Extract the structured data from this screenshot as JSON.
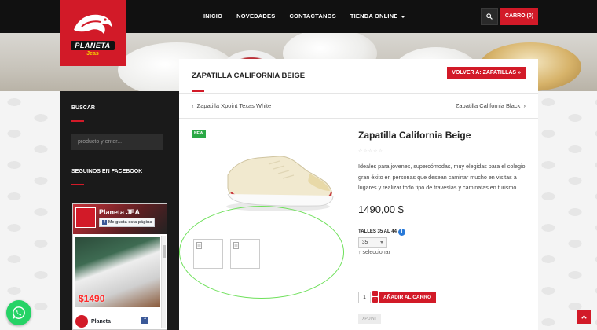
{
  "brand": {
    "logo_text": "PLANETA",
    "logo_sub": "Jeas"
  },
  "nav": {
    "items": [
      "INICIO",
      "NOVEDADES",
      "CONTACTANOS",
      "TIENDA ONLINE"
    ],
    "cart_label": "CARRO (0)"
  },
  "sidebar": {
    "search_title": "BUSCAR",
    "search_placeholder": "producto y enter...",
    "facebook_title": "SEGUINOS EN FACEBOOK",
    "fb_page_name": "Planeta JEA",
    "fb_like_label": "Me gusta esta página",
    "fb_post_price": "$1490",
    "fb_footer_name": "Planeta"
  },
  "page": {
    "title": "ZAPATILLA CALIFORNIA BEIGE",
    "back_button": "VOLVER A: ZAPATILLAS",
    "prev_product": "Zapatilla Xpoint Texas White",
    "next_product": "Zapatilla California Black"
  },
  "product": {
    "badge": "NEW",
    "name": "Zapatilla California Beige",
    "rating": 0,
    "stars": "☆☆☆☆☆",
    "description": "Ideales para jovenes, supercómodas, muy elegidas para el colegio, gran éxito en personas que desean caminar mucho en visitas a lugares y realizar todo tipo de travesías y caminatas en turismo.",
    "price": "1490,00 $",
    "size_label": "TALLES 35 AL 44",
    "size_selected": "35",
    "clear_selection": "↑ seleccionar",
    "quantity": "1",
    "add_to_cart": "AÑADIR AL CARRO",
    "tag": "XPOINT"
  },
  "colors": {
    "brand_red": "#d21a28",
    "navbar": "#111111",
    "sidebar": "#1a1a1a",
    "new_badge": "#2aa845",
    "whatsapp": "#25d366",
    "annotation_ellipse": "#6ee05a"
  }
}
